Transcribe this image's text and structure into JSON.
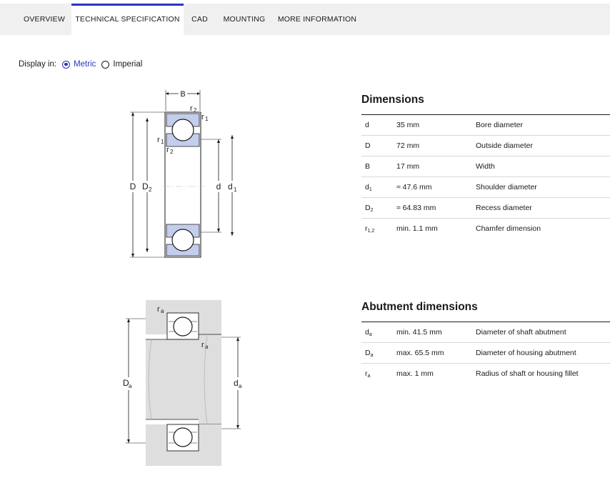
{
  "tabs": [
    {
      "label": "OVERVIEW",
      "active": false
    },
    {
      "label": "TECHNICAL SPECIFICATION",
      "active": true
    },
    {
      "label": "CAD",
      "active": false
    },
    {
      "label": "MOUNTING",
      "active": false
    },
    {
      "label": "MORE INFORMATION",
      "active": false
    }
  ],
  "display": {
    "label": "Display in:",
    "options": [
      {
        "label": "Metric",
        "selected": true
      },
      {
        "label": "Imperial",
        "selected": false
      }
    ]
  },
  "drawings": {
    "dimensions_labels": {
      "B": "B",
      "r2_top": "r",
      "r2_top_sub": "2",
      "r1_top": "r",
      "r1_top_sub": "1",
      "r1_side": "r",
      "r1_side_sub": "1",
      "r2_side": "r",
      "r2_side_sub": "2",
      "D": "D",
      "D2": "D",
      "D2_sub": "2",
      "d": "d",
      "d1": "d",
      "d1_sub": "1"
    },
    "abutment_labels": {
      "ra_top": "r",
      "ra_top_sub": "a",
      "ra_mid": "r",
      "ra_mid_sub": "a",
      "Da": "D",
      "Da_sub": "a",
      "da": "d",
      "da_sub": "a"
    }
  },
  "dimensions": {
    "title": "Dimensions",
    "rows": [
      {
        "sym": "d",
        "sub": "",
        "value": "35 mm",
        "desc": "Bore diameter"
      },
      {
        "sym": "D",
        "sub": "",
        "value": "72 mm",
        "desc": "Outside diameter"
      },
      {
        "sym": "B",
        "sub": "",
        "value": "17 mm",
        "desc": "Width"
      },
      {
        "sym": "d",
        "sub": "1",
        "value": "≈ 47.6 mm",
        "desc": "Shoulder diameter"
      },
      {
        "sym": "D",
        "sub": "2",
        "value": "≈ 64.83 mm",
        "desc": "Recess diameter"
      },
      {
        "sym": "r",
        "sub": "1,2",
        "value": "min. 1.1 mm",
        "desc": "Chamfer dimension"
      }
    ]
  },
  "abutment": {
    "title": "Abutment dimensions",
    "rows": [
      {
        "sym": "d",
        "sub": "a",
        "value": "min. 41.5 mm",
        "desc": "Diameter of shaft abutment"
      },
      {
        "sym": "D",
        "sub": "a",
        "value": "max. 65.5 mm",
        "desc": "Diameter of housing abutment"
      },
      {
        "sym": "r",
        "sub": "a",
        "value": "max. 1 mm",
        "desc": "Radius of shaft or housing fillet"
      }
    ]
  },
  "colors": {
    "accent": "#2b33c5",
    "ring_fill": "#c3cdec",
    "housing_fill": "#dedede"
  }
}
